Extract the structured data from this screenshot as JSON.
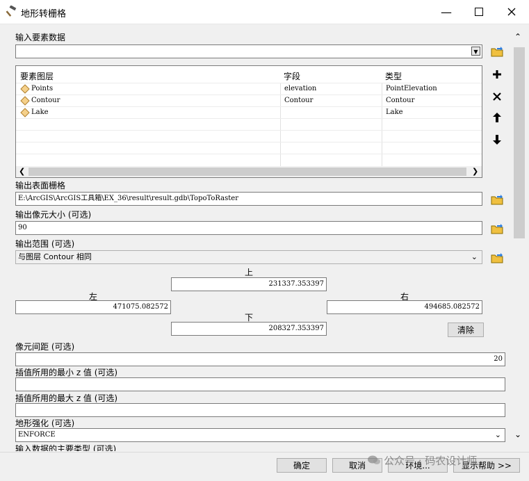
{
  "window": {
    "title": "地形转栅格"
  },
  "input_features": {
    "label": "输入要素数据",
    "value": "",
    "columns": [
      "要素图层",
      "字段",
      "类型"
    ],
    "rows": [
      {
        "layer": "Points",
        "field": "elevation",
        "type": "PointElevation"
      },
      {
        "layer": "Contour",
        "field": "Contour",
        "type": "Contour"
      },
      {
        "layer": "Lake",
        "field": "",
        "type": "Lake"
      }
    ]
  },
  "output_raster": {
    "label": "输出表面栅格",
    "value": "E:\\ArcGIS\\ArcGIS工具箱\\EX_36\\result\\result.gdb\\TopoToRaster"
  },
  "cell_size": {
    "label": "输出像元大小 (可选)",
    "value": "90"
  },
  "extent": {
    "label": "输出范围 (可选)",
    "value": "与图层 Contour 相同",
    "top_label": "上",
    "top": "231337.353397",
    "left_label": "左",
    "left": "471075.082572",
    "right_label": "右",
    "right": "494685.082572",
    "bottom_label": "下",
    "bottom": "208327.353397",
    "clear": "清除"
  },
  "margin": {
    "label": "像元间距 (可选)",
    "value": "20"
  },
  "min_z": {
    "label": "插值所用的最小 z 值 (可选)",
    "value": ""
  },
  "max_z": {
    "label": "插值所用的最大 z 值 (可选)",
    "value": ""
  },
  "enforce": {
    "label": "地形强化 (可选)",
    "value": "ENFORCE"
  },
  "primary_type": {
    "label": "输入数据的主要类型 (可选)"
  },
  "buttons": {
    "ok": "确定",
    "cancel": "取消",
    "env": "环境...",
    "help": "显示帮助 >>"
  },
  "watermark": "公众号 · 码农设计师"
}
